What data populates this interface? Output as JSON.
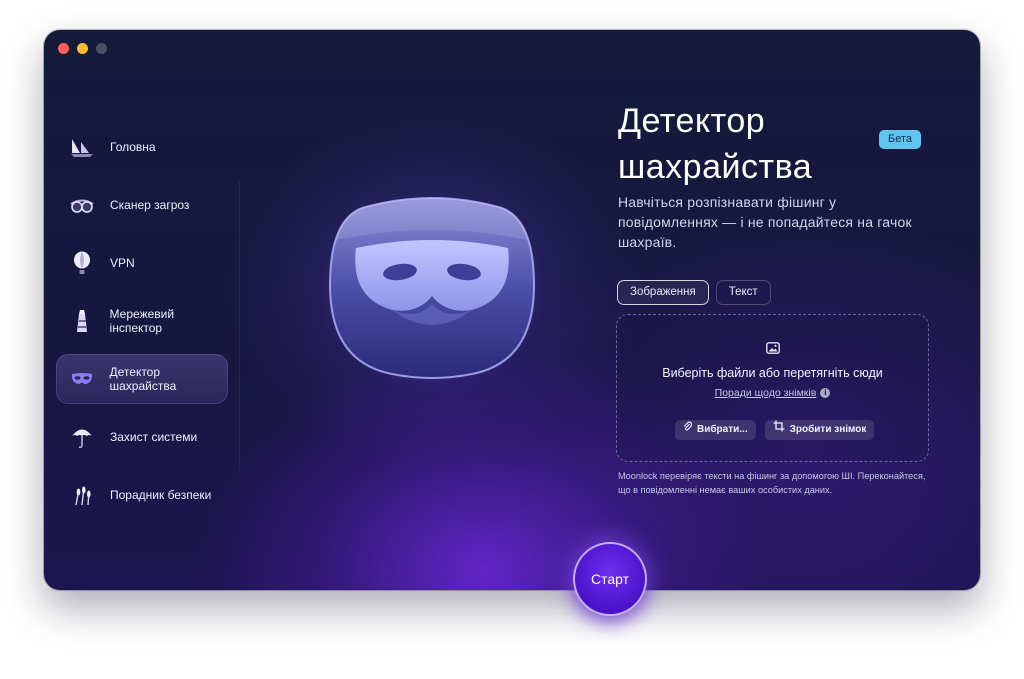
{
  "window": {
    "traffic_lights": [
      "close",
      "minimize",
      "zoom"
    ]
  },
  "sidebar": {
    "items": [
      {
        "label": "Головна",
        "icon": "ships-icon",
        "active": false
      },
      {
        "label": "Сканер загроз",
        "icon": "goggles-icon",
        "active": false
      },
      {
        "label": "VPN",
        "icon": "hot-air-balloon-icon",
        "active": false
      },
      {
        "label": "Мережевий інспектор",
        "icon": "lighthouse-icon",
        "active": false
      },
      {
        "label": "Детектор шахрайства",
        "icon": "mask-icon",
        "active": true
      },
      {
        "label": "Захист системи",
        "icon": "umbrella-icon",
        "active": false
      },
      {
        "label": "Порадник безпеки",
        "icon": "wheat-icon",
        "active": false
      }
    ]
  },
  "main": {
    "title_line1": "Детектор",
    "title_line2": "шахрайства",
    "badge": "Бета",
    "subtitle": "Навчіться розпізнавати фішинг у повідомленнях — і не попадайтеся на гачок шахраїв.",
    "tabs": [
      {
        "label": "Зображення",
        "active": true
      },
      {
        "label": "Текст",
        "active": false
      }
    ],
    "dropzone": {
      "icon": "image-icon",
      "text": "Виберіть файли або перетягніть сюди",
      "tips_link": "Поради щодо знімків",
      "choose_button": "Вибрати...",
      "screenshot_button": "Зробити знімок"
    },
    "note": "Moonlock перевіряє тексти на фішинг за допомогою ШІ. Переконайтеся, що в повідомленні немає ваших особистих даних.",
    "start_button": "Старт"
  },
  "colors": {
    "accent": "#5b22e0",
    "badge": "#5fc4f0",
    "background": "#17163f"
  }
}
